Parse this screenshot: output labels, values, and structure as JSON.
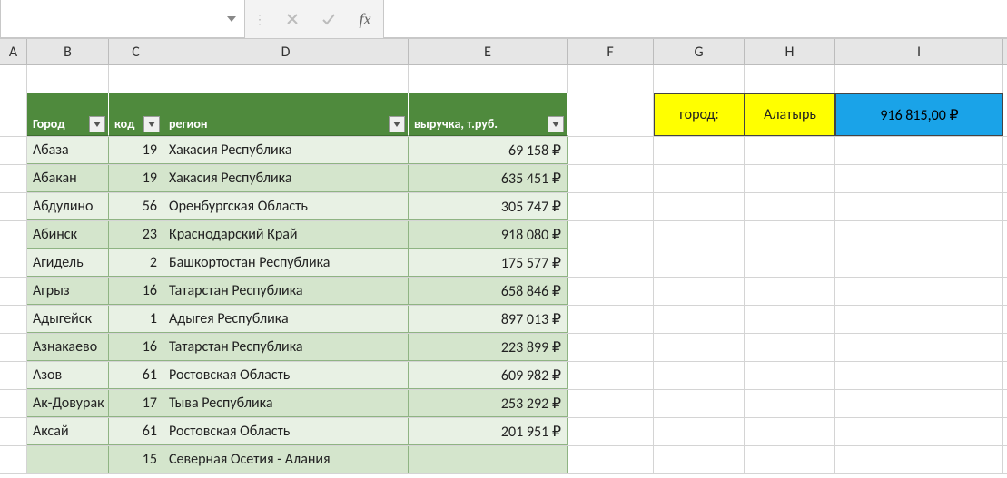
{
  "formula_bar": {
    "name_box": "",
    "formula": ""
  },
  "columns": [
    "A",
    "B",
    "C",
    "D",
    "E",
    "F",
    "G",
    "H",
    "I"
  ],
  "table": {
    "headers": [
      "Город",
      "код",
      "регион",
      "выручка, т.руб."
    ],
    "rows": [
      {
        "city": "Абаза",
        "code": "19",
        "region": "Хакасия Республика",
        "revenue": "69 158 ₽"
      },
      {
        "city": "Абакан",
        "code": "19",
        "region": "Хакасия Республика",
        "revenue": "635 451 ₽"
      },
      {
        "city": "Абдулино",
        "code": "56",
        "region": "Оренбургская Область",
        "revenue": "305 747 ₽"
      },
      {
        "city": "Абинск",
        "code": "23",
        "region": "Краснодарский Край",
        "revenue": "918 080 ₽"
      },
      {
        "city": "Агидель",
        "code": "2",
        "region": "Башкортостан Республика",
        "revenue": "175 577 ₽"
      },
      {
        "city": "Агрыз",
        "code": "16",
        "region": "Татарстан Республика",
        "revenue": "658 846 ₽"
      },
      {
        "city": "Адыгейск",
        "code": "1",
        "region": "Адыгея Республика",
        "revenue": "897 013 ₽"
      },
      {
        "city": "Азнакаево",
        "code": "16",
        "region": "Татарстан Республика",
        "revenue": "223 899 ₽"
      },
      {
        "city": "Азов",
        "code": "61",
        "region": "Ростовская Область",
        "revenue": "609 982 ₽"
      },
      {
        "city": "Ак-Довурак",
        "code": "17",
        "region": "Тыва Республика",
        "revenue": "253 292 ₽"
      },
      {
        "city": "Аксай",
        "code": "61",
        "region": "Ростовская Область",
        "revenue": "201 951 ₽"
      },
      {
        "city": "",
        "code": "15",
        "region": "Северная Осетия - Алания",
        "revenue": ""
      }
    ]
  },
  "lookup": {
    "label": "город:",
    "value": "Алатырь",
    "result": "916 815,00 ₽"
  }
}
